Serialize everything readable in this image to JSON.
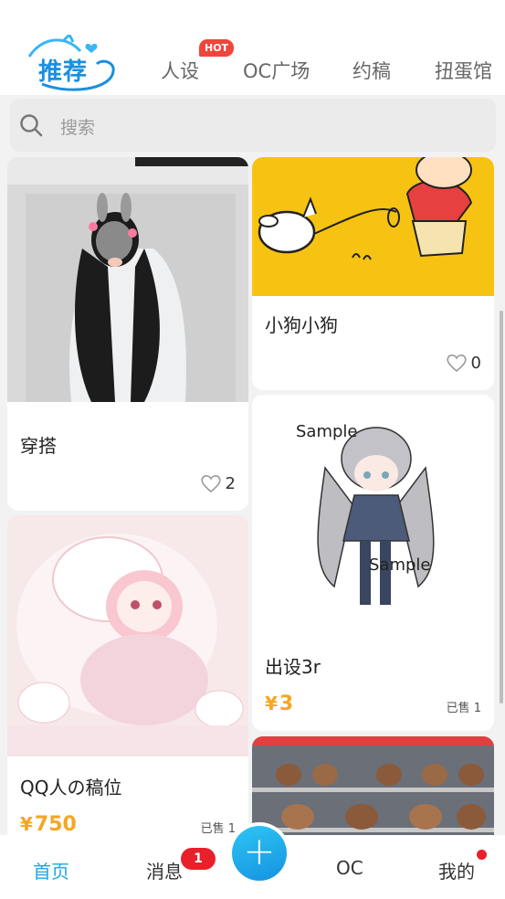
{
  "header": {
    "logo_text": "推荐",
    "tabs": [
      {
        "label": "人设",
        "badge": "HOT"
      },
      {
        "label": "OC广场"
      },
      {
        "label": "约稿"
      },
      {
        "label": "扭蛋馆"
      }
    ]
  },
  "search": {
    "placeholder": "搜索"
  },
  "feed": {
    "cards": [
      {
        "title": "穿搭",
        "likes": "2"
      },
      {
        "title": "小狗小狗",
        "likes": "0"
      },
      {
        "title": "出设3r",
        "price_symbol": "¥",
        "price": "3",
        "sold": "已售 1"
      },
      {
        "title": "QQ人の稿位",
        "price_symbol": "¥",
        "price": "750",
        "sold": "已售 1"
      }
    ]
  },
  "bottom_nav": {
    "home": "首页",
    "messages": "消息",
    "messages_badge": "1",
    "oc": "OC",
    "me": "我的",
    "add_icon": "+"
  },
  "colors": {
    "accent": "#1aa7e8",
    "price": "#f5a623",
    "badge": "#e8202a",
    "hot": "#f0453a"
  }
}
